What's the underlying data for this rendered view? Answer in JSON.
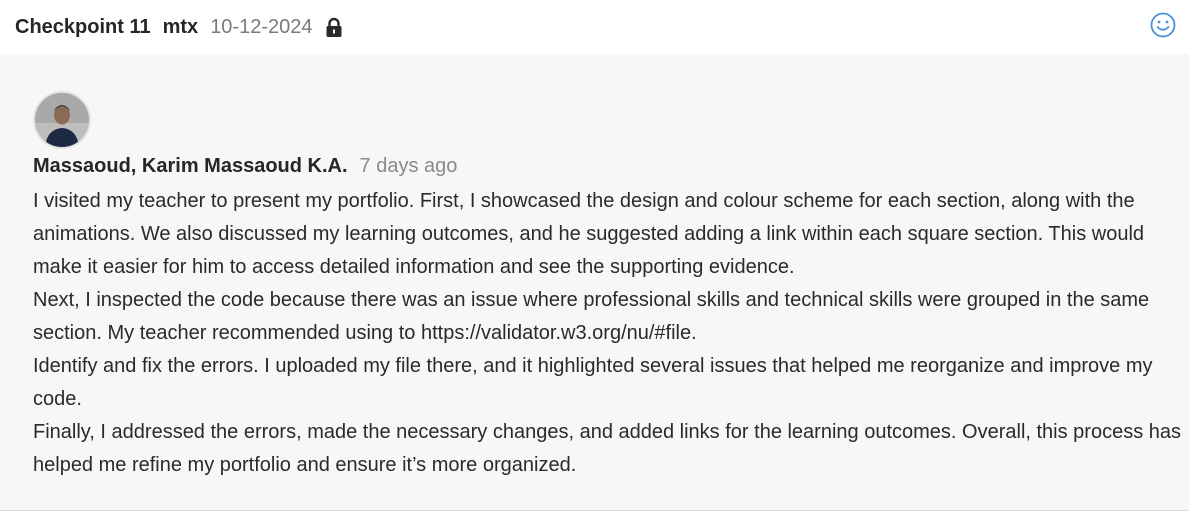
{
  "header": {
    "title": "Checkpoint 11",
    "author_code": "mtx",
    "date": "10-12-2024",
    "lock_icon": "lock-icon",
    "reaction_icon": "smiley-icon"
  },
  "comment": {
    "avatar_icon": "user-avatar",
    "author": "Massaoud, Karim Massaoud K.A.",
    "time": "7 days ago",
    "paragraphs": [
      "I visited my teacher to present my portfolio. First, I showcased the design and colour scheme for each section, along with the animations. We also discussed my learning outcomes, and he suggested adding a link within each square section. This would make it easier for him to access detailed information and see the supporting evidence.",
      "Next, I inspected the code because there was an issue where professional skills and technical skills were grouped in the same section. My teacher recommended using to https://validator.w3.org/nu/#file.",
      "Identify and fix the errors. I uploaded my file there, and it highlighted several issues that helped me reorganize and improve my code.",
      "Finally, I addressed the errors, made the necessary changes, and added links for the learning outcomes. Overall, this process has helped me refine my portfolio and ensure it’s more organized."
    ]
  },
  "colors": {
    "panel_bg": "#f7f7f7",
    "accent": "#4a90d9",
    "muted_text": "#8a8a8a"
  }
}
